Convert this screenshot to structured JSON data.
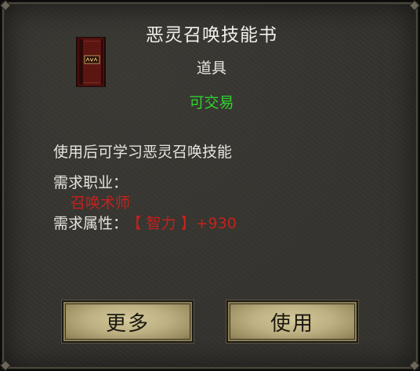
{
  "tooltip": {
    "title": "恶灵召唤技能书",
    "item_type": "道具",
    "tradable": "可交易",
    "description": "使用后可学习恶灵召唤技能",
    "required_class_label": "需求职业：",
    "required_class_value": "召唤术师",
    "required_attr_label": "需求属性：",
    "required_attr_value": "【 智力 】+930"
  },
  "buttons": {
    "more_label": "更多",
    "use_label": "使用"
  },
  "icon": "red-spell-book-icon",
  "colors": {
    "panel_bg": "#34332f",
    "title_text": "#f2f0ea",
    "tradable_green": "#2fd22f",
    "requirement_red": "#c8201c",
    "button_gold": "#bdb082"
  }
}
